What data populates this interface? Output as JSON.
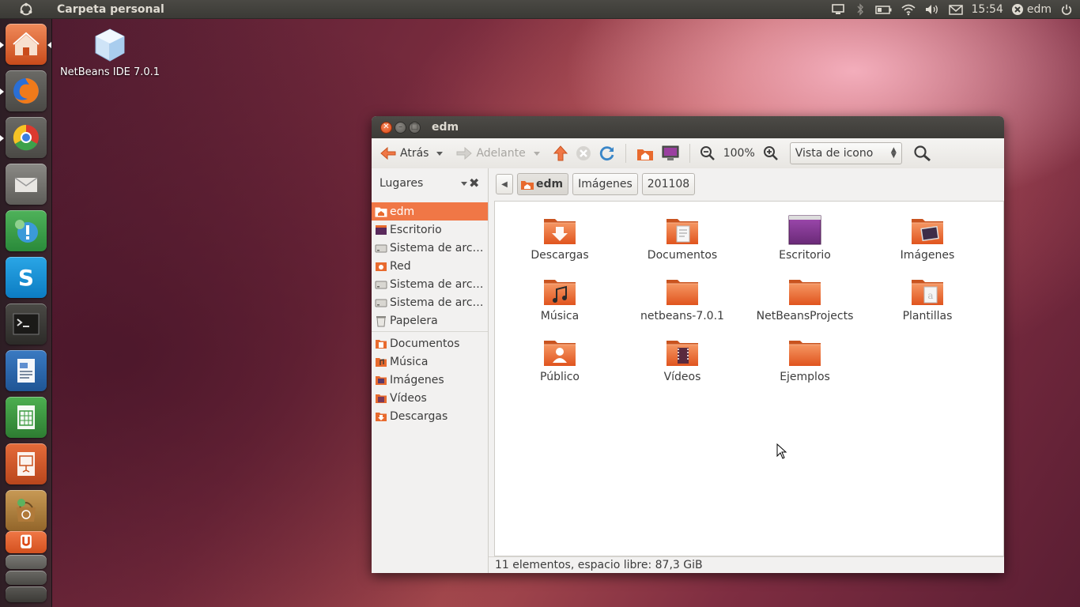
{
  "top_panel": {
    "title": "Carpeta personal",
    "clock": "15:54",
    "user": "edm",
    "indicators": [
      "display-icon",
      "bluetooth-icon",
      "battery-icon",
      "wifi-icon",
      "volume-icon",
      "mail-icon",
      "user-icon",
      "power-icon"
    ]
  },
  "launcher": {
    "items": [
      "home-folder",
      "firefox",
      "chromium",
      "mail-client",
      "chat",
      "skype",
      "terminal",
      "writer",
      "calc",
      "impress",
      "software-center",
      "ubuntu-one",
      "workspaces",
      "trash"
    ]
  },
  "desktop": {
    "icon_label": "NetBeans IDE 7.0.1"
  },
  "window": {
    "title": "edm",
    "toolbar": {
      "back": "Atrás",
      "forward": "Adelante",
      "zoom": "100%",
      "view_mode": "Vista de icono"
    },
    "sidebar": {
      "header": "Lugares",
      "places": [
        {
          "label": "edm",
          "icon": "home-folder-icon",
          "selected": true
        },
        {
          "label": "Escritorio",
          "icon": "desktop-folder-icon"
        },
        {
          "label": "Sistema de arc…",
          "icon": "drive-icon"
        },
        {
          "label": "Red",
          "icon": "network-icon"
        },
        {
          "label": "Sistema de arc…",
          "icon": "drive-icon"
        },
        {
          "label": "Sistema de arc…",
          "icon": "drive-icon"
        },
        {
          "label": "Papelera",
          "icon": "trash-icon"
        }
      ],
      "bookmarks": [
        {
          "label": "Documentos",
          "icon": "documents-folder-icon"
        },
        {
          "label": "Música",
          "icon": "music-folder-icon"
        },
        {
          "label": "Imágenes",
          "icon": "pictures-folder-icon"
        },
        {
          "label": "Vídeos",
          "icon": "videos-folder-icon"
        },
        {
          "label": "Descargas",
          "icon": "downloads-folder-icon"
        }
      ]
    },
    "pathbar": [
      "edm",
      "Imágenes",
      "201108"
    ],
    "files": [
      {
        "label": "Descargas",
        "icon": "downloads"
      },
      {
        "label": "Documentos",
        "icon": "documents"
      },
      {
        "label": "Escritorio",
        "icon": "desktop"
      },
      {
        "label": "Imágenes",
        "icon": "pictures"
      },
      {
        "label": "Música",
        "icon": "music"
      },
      {
        "label": "netbeans-7.0.1",
        "icon": "folder"
      },
      {
        "label": "NetBeansProjects",
        "icon": "folder"
      },
      {
        "label": "Plantillas",
        "icon": "templates"
      },
      {
        "label": "Público",
        "icon": "public"
      },
      {
        "label": "Vídeos",
        "icon": "videos"
      },
      {
        "label": "Ejemplos",
        "icon": "folder"
      }
    ],
    "status": "11 elementos, espacio libre: 87,3 GiB"
  },
  "colors": {
    "accent": "#f07746",
    "folder": "#e86a2e",
    "panel": "#3c3b37"
  }
}
